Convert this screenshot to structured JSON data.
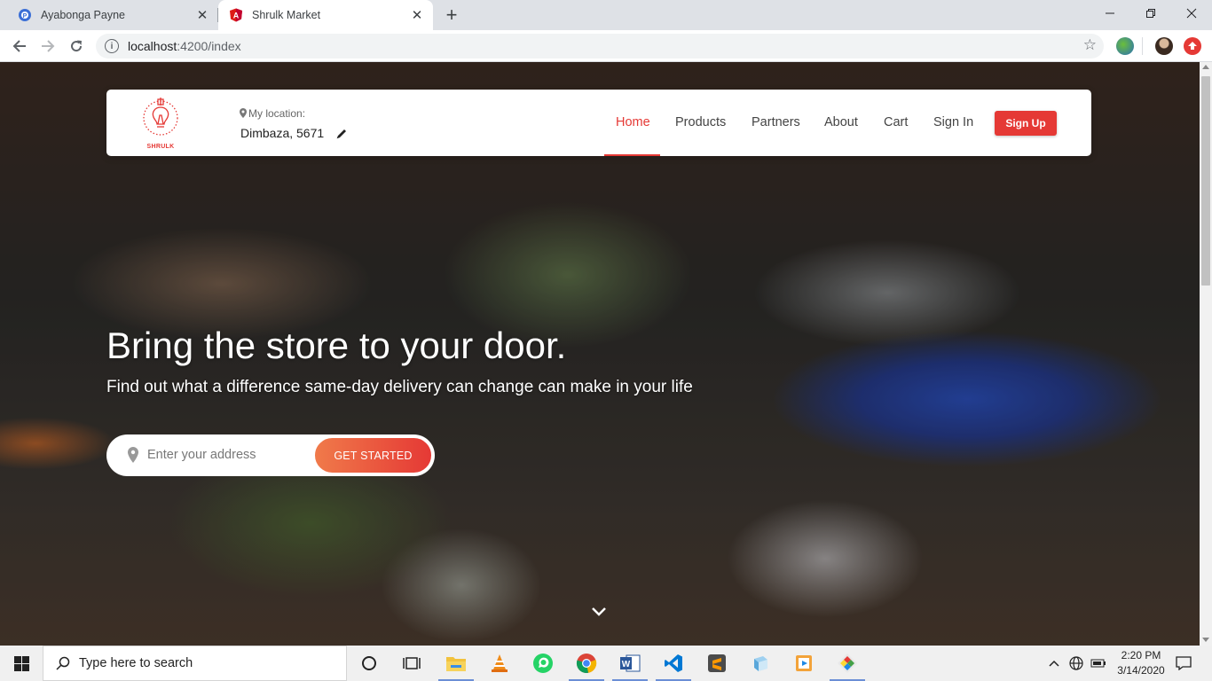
{
  "browser": {
    "tabs": [
      {
        "title": "Ayabonga Payne",
        "favicon": "p-circle-icon",
        "active": false
      },
      {
        "title": "Shrulk Market",
        "favicon": "angular-icon",
        "active": true
      }
    ],
    "url_host": "localhost",
    "url_rest": ":4200/index"
  },
  "site": {
    "logo_text": "SHRULK",
    "location_label": "My location:",
    "location_value": "Dimbaza, 5671",
    "nav": [
      {
        "label": "Home",
        "active": true
      },
      {
        "label": "Products",
        "active": false
      },
      {
        "label": "Partners",
        "active": false
      },
      {
        "label": "About",
        "active": false
      },
      {
        "label": "Cart",
        "active": false
      },
      {
        "label": "Sign In",
        "active": false
      }
    ],
    "signup_label": "Sign Up",
    "accent_color": "#e53935"
  },
  "hero": {
    "title": "Bring the store to your door.",
    "subtitle": "Find out what a difference same-day delivery can change can make in your life",
    "address_placeholder": "Enter your address",
    "cta_label": "GET STARTED"
  },
  "taskbar": {
    "search_placeholder": "Type here to search",
    "time": "2:20 PM",
    "date": "3/14/2020"
  }
}
